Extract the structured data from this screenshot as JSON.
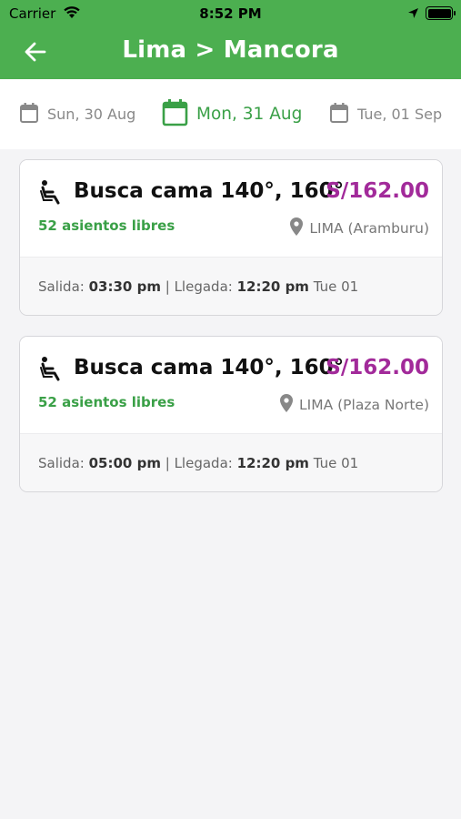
{
  "status_bar": {
    "carrier": "Carrier",
    "time": "8:52 PM"
  },
  "header": {
    "title": "Lima > Mancora",
    "color": "#4caf50"
  },
  "dates": [
    {
      "label": "Sun, 30 Aug",
      "active": false
    },
    {
      "label": "Mon, 31 Aug",
      "active": true
    },
    {
      "label": "Tue, 01 Sep",
      "active": false
    }
  ],
  "trips": [
    {
      "service": "Busca cama 140°, 160°",
      "price": "S/162.00",
      "seats": "52 asientos libres",
      "origin": "LIMA (Aramburu)",
      "departure_label": "Salida:",
      "departure_time": "03:30 pm",
      "separator": "|",
      "arrival_label": "Llegada:",
      "arrival_time": "12:20 pm",
      "arrival_day": "Tue 01"
    },
    {
      "service": "Busca cama 140°, 160°",
      "price": "S/162.00",
      "seats": "52 asientos libres",
      "origin": "LIMA (Plaza Norte)",
      "departure_label": "Salida:",
      "departure_time": "05:00 pm",
      "separator": "|",
      "arrival_label": "Llegada:",
      "arrival_time": "12:20 pm",
      "arrival_day": "Tue 01"
    }
  ],
  "colors": {
    "accent_green": "#3aa047",
    "price_purple": "#a22a9a"
  },
  "icons": [
    "back-arrow-icon",
    "calendar-icon",
    "seat-icon",
    "location-pin-icon",
    "wifi-icon",
    "location-arrow-icon",
    "battery-icon"
  ]
}
